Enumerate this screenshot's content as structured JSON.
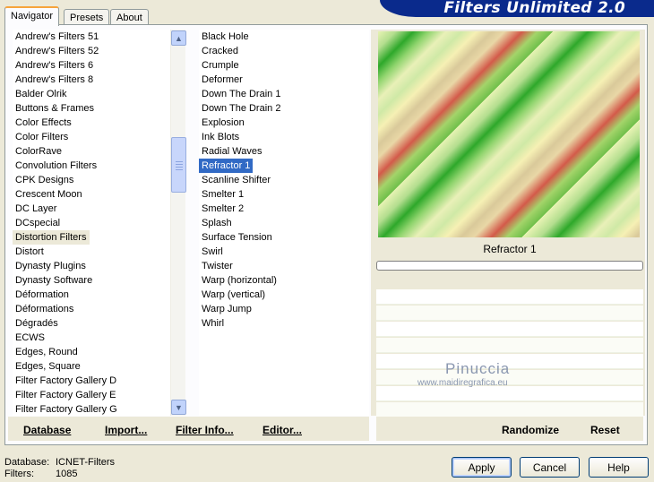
{
  "app_title": "Filters Unlimited 2.0",
  "tabs": [
    "Navigator",
    "Presets",
    "About"
  ],
  "categories": [
    "Andrew's Filters 51",
    "Andrew's Filters 52",
    "Andrew's Filters 6",
    "Andrew's Filters 8",
    "Balder Olrik",
    "Buttons & Frames",
    "Color Effects",
    "Color Filters",
    "ColorRave",
    "Convolution Filters",
    "CPK Designs",
    "Crescent Moon",
    "DC Layer",
    "DCspecial",
    "Distortion Filters",
    "Distort",
    "Dynasty Plugins",
    "Dynasty Software",
    "Déformation",
    "Déformations",
    "Dégradés",
    "ECWS",
    "Edges, Round",
    "Edges, Square",
    "Filter Factory Gallery D",
    "Filter Factory Gallery E",
    "Filter Factory Gallery G"
  ],
  "selected_category": "Distortion Filters",
  "filters": [
    "Black Hole",
    "Cracked",
    "Crumple",
    "Deformer",
    "Down The Drain 1",
    "Down The Drain 2",
    "Explosion",
    "Ink Blots",
    "Radial Waves",
    "Refractor 1",
    "Scanline Shifter",
    "Smelter 1",
    "Smelter 2",
    "Splash",
    "Surface Tension",
    "Swirl",
    "Twister",
    "Warp (horizontal)",
    "Warp (vertical)",
    "Warp Jump",
    "Whirl"
  ],
  "selected_filter": "Refractor 1",
  "preview_label": "Refractor 1",
  "watermark": {
    "name": "Pinuccia",
    "url": "www.maidiregrafica.eu"
  },
  "left_buttons": {
    "database": "Database",
    "import": "Import...",
    "filter_info": "Filter Info...",
    "editor": "Editor..."
  },
  "right_buttons": {
    "randomize": "Randomize",
    "reset": "Reset"
  },
  "dialog_buttons": {
    "apply": "Apply",
    "cancel": "Cancel",
    "help": "Help"
  },
  "footer": {
    "database_label": "Database:",
    "database_value": "ICNET-Filters",
    "filters_label": "Filters:",
    "filters_value": "1085"
  },
  "colors": {
    "banner": "#0a2a8c",
    "selection": "#316ac5",
    "tab_accent": "#f6a43c"
  },
  "scrollbar_icons": {
    "up": "arrow-up-icon",
    "down": "arrow-down-icon"
  }
}
